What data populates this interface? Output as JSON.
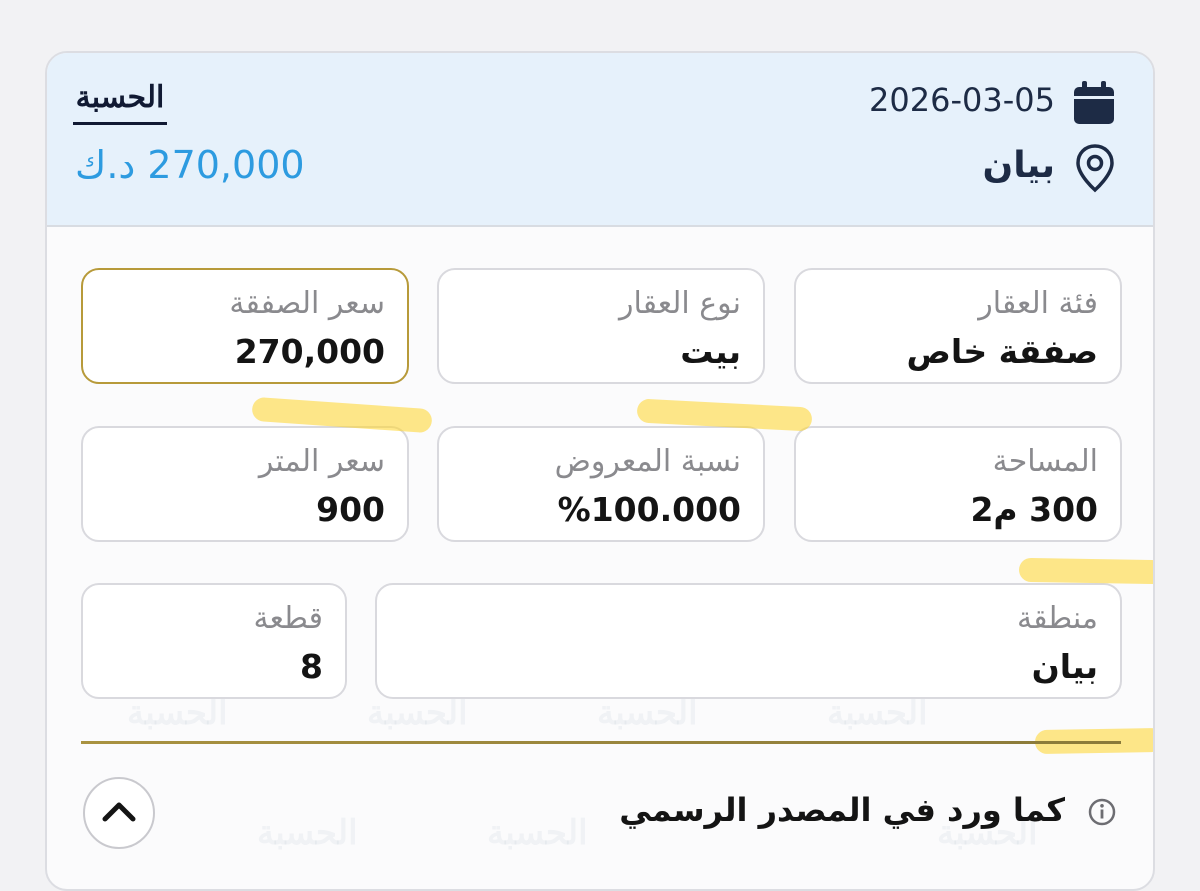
{
  "header": {
    "date": "2026-03-05",
    "location": "بيان",
    "logo_text": "الحسبة",
    "price": "270,000 د.ك"
  },
  "fields": [
    {
      "label": "فئة العقار",
      "value": "صفقة خاص"
    },
    {
      "label": "نوع العقار",
      "value": "بيت"
    },
    {
      "label": "سعر الصفقة",
      "value": "270,000"
    },
    {
      "label": "المساحة",
      "value": "300 م2"
    },
    {
      "label": "نسبة المعروض",
      "value": "%100.000"
    },
    {
      "label": "سعر المتر",
      "value": "900"
    },
    {
      "label": "منطقة",
      "value": "بيان"
    },
    {
      "label": "قطعة",
      "value": "8"
    }
  ],
  "footer": {
    "source_text": "كما ورد في المصدر الرسمي"
  },
  "icons": {
    "calendar": "calendar-icon",
    "location": "map-pin-icon",
    "info": "info-icon",
    "collapse": "chevron-up-icon"
  },
  "colors": {
    "accent": "#2d9be0",
    "header_bg": "#e6f1fb",
    "highlight_border": "#b79a3a",
    "text_dark": "#1d2b45"
  }
}
